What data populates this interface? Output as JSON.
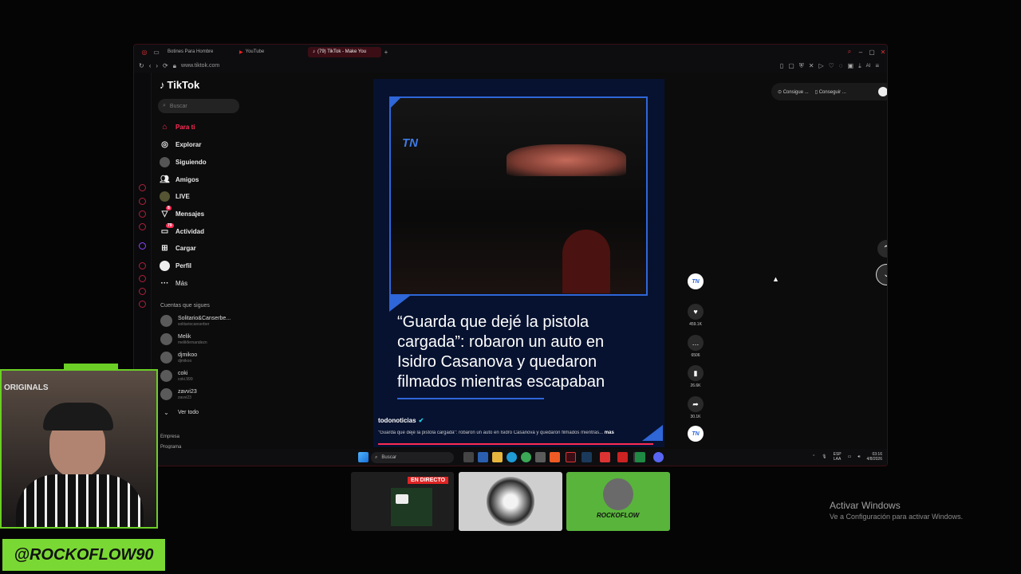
{
  "browser": {
    "tabs": [
      {
        "label": "Botines Para Hombre",
        "active": false
      },
      {
        "label": "YouTube",
        "active": false
      },
      {
        "label": "(79) TikTok - Make You",
        "active": true
      }
    ],
    "new_tab": "+",
    "url": "www.tiktok.com"
  },
  "tiktok": {
    "logo": "TikTok",
    "search_placeholder": "Buscar",
    "nav": [
      {
        "label": "Para ti",
        "icon": "home-icon"
      },
      {
        "label": "Explorar",
        "icon": "compass-icon"
      },
      {
        "label": "Siguiendo",
        "icon": "following-icon"
      },
      {
        "label": "Amigos",
        "icon": "friends-icon"
      },
      {
        "label": "LIVE",
        "icon": "live-icon"
      },
      {
        "label": "Mensajes",
        "icon": "messages-icon",
        "badge": "8"
      },
      {
        "label": "Actividad",
        "icon": "activity-icon",
        "badge": "79"
      },
      {
        "label": "Cargar",
        "icon": "upload-icon"
      },
      {
        "label": "Perfil",
        "icon": "profile-icon"
      },
      {
        "label": "Más",
        "icon": "more-icon"
      }
    ],
    "following_title": "Cuentas que sigues",
    "accounts": [
      {
        "name": "Solitario&Canserbe...",
        "handle": "solitariocanserber"
      },
      {
        "name": "Melik",
        "handle": "melikfernandezn"
      },
      {
        "name": "djmikoo",
        "handle": "djmikoo"
      },
      {
        "name": "coki",
        "handle": "coki.999"
      },
      {
        "name": "zavvi23",
        "handle": "zavvi23"
      }
    ],
    "see_all": "Ver todo",
    "footer": [
      "Empresa",
      "Programa"
    ],
    "topright": {
      "coins_label": "Consigue ...",
      "app_label": "Conseguir ..."
    },
    "video": {
      "brand": "TN",
      "headline": "“Guarda que dejé la pistola cargada”: robaron un auto en Isidro Casanova y quedaron filmados mientras escapaban",
      "channel": "todonoticias",
      "caption": "\"Guarda que dejé la pistola cargada\": robaron un auto en Isidro Casanova y quedaron filmados mientras...",
      "more": "más"
    },
    "actions": [
      {
        "icon": "heart-icon",
        "count": "459.1K"
      },
      {
        "icon": "comment-icon",
        "count": "6506"
      },
      {
        "icon": "bookmark-icon",
        "count": "26.6K"
      },
      {
        "icon": "share-icon",
        "count": "30.1K"
      }
    ]
  },
  "taskbar": {
    "search": "Buscar",
    "lang": "ESP",
    "lang2": "LAA",
    "time": "03:16",
    "date": "4/8/2026"
  },
  "overlay": {
    "webcam_label": "ORIGINALS",
    "nameplate": "@ROCKOFLOW90",
    "live_badge": "EN DIRECTO",
    "thumb_logo": "ROCKOFLOW",
    "activate_title": "Activar Windows",
    "activate_sub": "Ve a Configuración para activar Windows."
  }
}
